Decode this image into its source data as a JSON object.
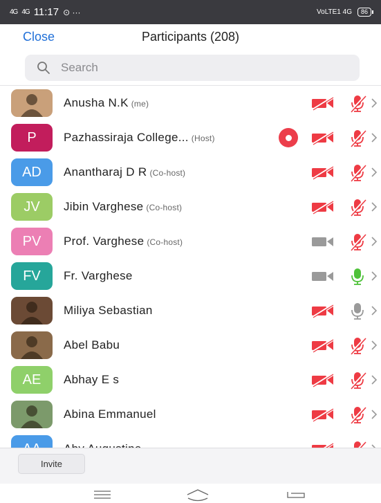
{
  "status_bar": {
    "signal_1": "4G",
    "signal_2": "4G",
    "time": "11:17",
    "extra": "⊙ ···",
    "right_network": "VoLTE1 4G",
    "battery": "86"
  },
  "header": {
    "close_label": "Close",
    "title": "Participants (208)"
  },
  "search": {
    "placeholder": "Search"
  },
  "colors": {
    "accent": "#1f6fd8",
    "muted_red": "#ee3b44",
    "recording_red": "#ec3e4b",
    "mic_on_green": "#4fc23a",
    "neutral_gray": "#9a9a9a"
  },
  "participants": [
    {
      "name": "Anusha N.K",
      "role": "(me)",
      "avatar_initials": "",
      "avatar_color": "#c9a07a",
      "video": "off",
      "mic": "muted",
      "recording": false
    },
    {
      "name": "Pazhassiraja College...",
      "role": "(Host)",
      "avatar_initials": "P",
      "avatar_color": "#c21d5c",
      "video": "off",
      "mic": "muted",
      "recording": true
    },
    {
      "name": "Anantharaj D R",
      "role": "(Co-host)",
      "avatar_initials": "AD",
      "avatar_color": "#4a9be8",
      "video": "off",
      "mic": "muted",
      "recording": false
    },
    {
      "name": "Jibin Varghese",
      "role": "(Co-host)",
      "avatar_initials": "JV",
      "avatar_color": "#9ccc65",
      "video": "off",
      "mic": "muted",
      "recording": false
    },
    {
      "name": "Prof. Varghese",
      "role": "(Co-host)",
      "avatar_initials": "PV",
      "avatar_color": "#ec7fb4",
      "video": "gray",
      "mic": "muted",
      "recording": false
    },
    {
      "name": "Fr. Varghese",
      "role": "",
      "avatar_initials": "FV",
      "avatar_color": "#26a69a",
      "video": "gray",
      "mic": "on",
      "recording": false
    },
    {
      "name": "Miliya Sebastian",
      "role": "",
      "avatar_initials": "",
      "avatar_color": "#6b4a35",
      "video": "off",
      "mic": "gray",
      "recording": false
    },
    {
      "name": "Abel Babu",
      "role": "",
      "avatar_initials": "",
      "avatar_color": "#8a6a4a",
      "video": "off",
      "mic": "muted",
      "recording": false
    },
    {
      "name": "Abhay E s",
      "role": "",
      "avatar_initials": "AE",
      "avatar_color": "#8fd06a",
      "video": "off",
      "mic": "muted",
      "recording": false
    },
    {
      "name": "Abina Emmanuel",
      "role": "",
      "avatar_initials": "",
      "avatar_color": "#7c9a6b",
      "video": "off",
      "mic": "muted",
      "recording": false
    },
    {
      "name": "Aby Augustine",
      "role": "",
      "avatar_initials": "AA",
      "avatar_color": "#4a9be8",
      "video": "off",
      "mic": "muted",
      "recording": false
    }
  ],
  "bottom_bar": {
    "invite_label": "Invite"
  },
  "nav_bar": {
    "menu_icon": "menu-icon",
    "home_icon": "home-icon",
    "back_icon": "back-icon"
  }
}
